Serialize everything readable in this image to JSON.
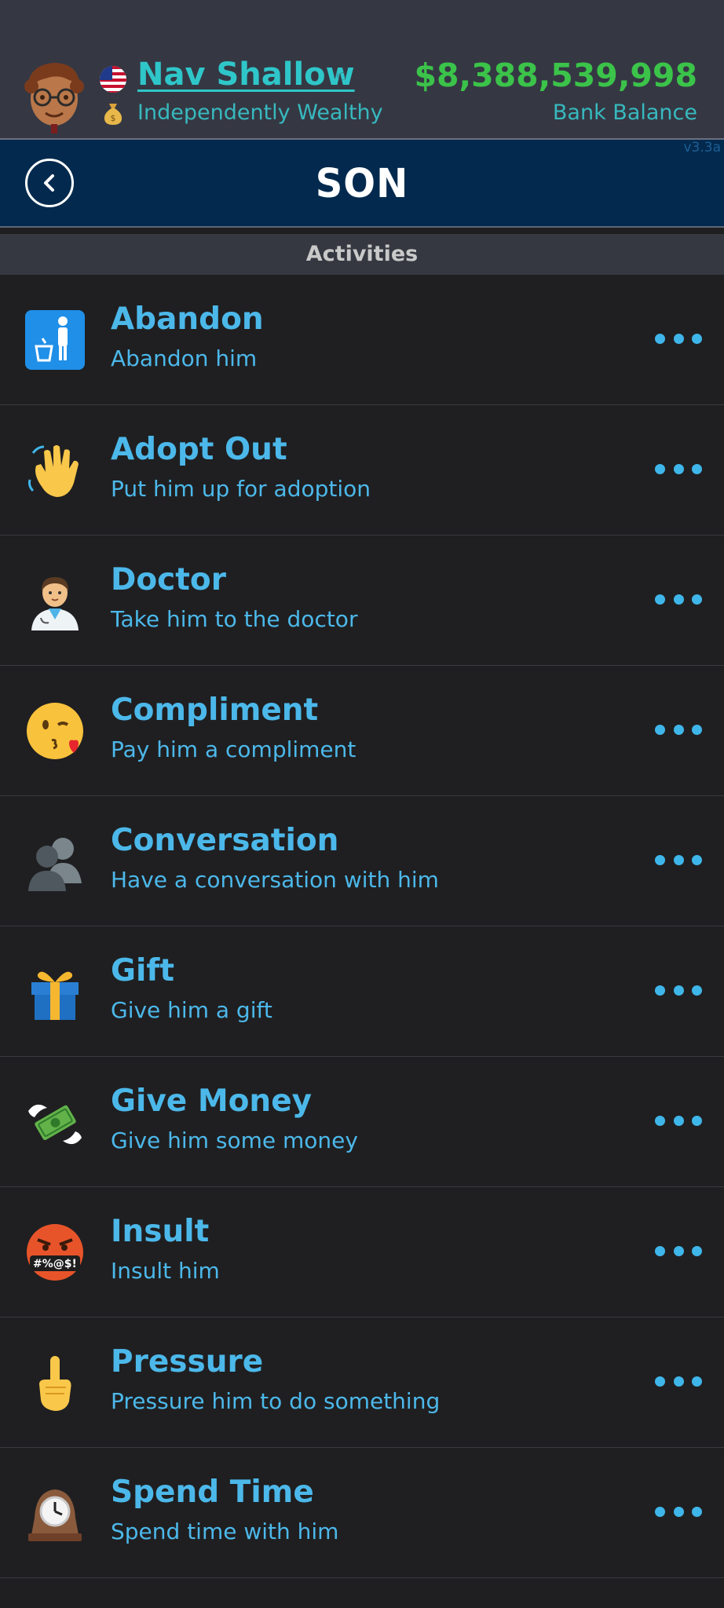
{
  "header": {
    "name": "Nav Shallow",
    "status": "Independently Wealthy",
    "balance": "$8,388,539,998",
    "balance_label": "Bank Balance",
    "version": "v3.3a"
  },
  "nav": {
    "title": "SON"
  },
  "section": {
    "title": "Activities"
  },
  "activities": [
    {
      "title": "Abandon",
      "subtitle": "Abandon him",
      "icon": "trash-person-icon"
    },
    {
      "title": "Adopt Out",
      "subtitle": "Put him up for adoption",
      "icon": "waving-hand-icon"
    },
    {
      "title": "Doctor",
      "subtitle": "Take him to the doctor",
      "icon": "doctor-icon"
    },
    {
      "title": "Compliment",
      "subtitle": "Pay him a compliment",
      "icon": "kiss-face-icon"
    },
    {
      "title": "Conversation",
      "subtitle": "Have a conversation with him",
      "icon": "people-silhouette-icon"
    },
    {
      "title": "Gift",
      "subtitle": "Give him a gift",
      "icon": "gift-icon"
    },
    {
      "title": "Give Money",
      "subtitle": "Give him some money",
      "icon": "money-wings-icon"
    },
    {
      "title": "Insult",
      "subtitle": "Insult him",
      "icon": "cursing-face-icon"
    },
    {
      "title": "Pressure",
      "subtitle": "Pressure him to do something",
      "icon": "pointing-up-icon"
    },
    {
      "title": "Spend Time",
      "subtitle": "Spend time with him",
      "icon": "mantel-clock-icon"
    }
  ],
  "colors": {
    "accent": "#4cb8ea",
    "money": "#3bc34a",
    "teal": "#2fc6c9",
    "navbar": "#032a4e",
    "background": "#1f1f21"
  }
}
